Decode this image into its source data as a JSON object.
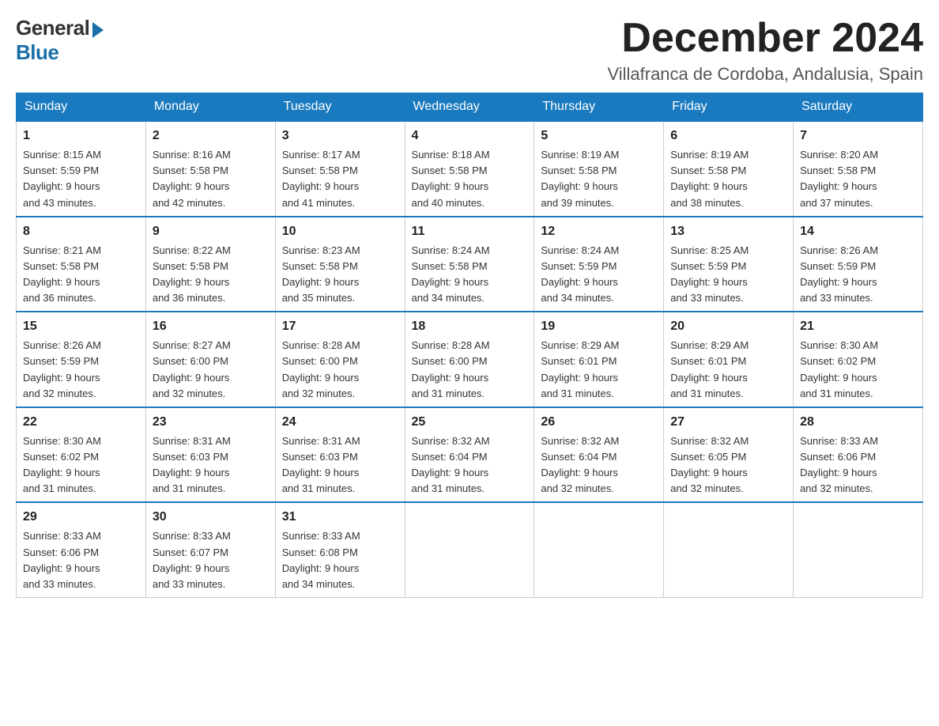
{
  "header": {
    "logo_general": "General",
    "logo_blue": "Blue",
    "month_title": "December 2024",
    "location": "Villafranca de Cordoba, Andalusia, Spain"
  },
  "days_of_week": [
    "Sunday",
    "Monday",
    "Tuesday",
    "Wednesday",
    "Thursday",
    "Friday",
    "Saturday"
  ],
  "weeks": [
    [
      {
        "day": "1",
        "sunrise": "8:15 AM",
        "sunset": "5:59 PM",
        "daylight": "9 hours and 43 minutes."
      },
      {
        "day": "2",
        "sunrise": "8:16 AM",
        "sunset": "5:58 PM",
        "daylight": "9 hours and 42 minutes."
      },
      {
        "day": "3",
        "sunrise": "8:17 AM",
        "sunset": "5:58 PM",
        "daylight": "9 hours and 41 minutes."
      },
      {
        "day": "4",
        "sunrise": "8:18 AM",
        "sunset": "5:58 PM",
        "daylight": "9 hours and 40 minutes."
      },
      {
        "day": "5",
        "sunrise": "8:19 AM",
        "sunset": "5:58 PM",
        "daylight": "9 hours and 39 minutes."
      },
      {
        "day": "6",
        "sunrise": "8:19 AM",
        "sunset": "5:58 PM",
        "daylight": "9 hours and 38 minutes."
      },
      {
        "day": "7",
        "sunrise": "8:20 AM",
        "sunset": "5:58 PM",
        "daylight": "9 hours and 37 minutes."
      }
    ],
    [
      {
        "day": "8",
        "sunrise": "8:21 AM",
        "sunset": "5:58 PM",
        "daylight": "9 hours and 36 minutes."
      },
      {
        "day": "9",
        "sunrise": "8:22 AM",
        "sunset": "5:58 PM",
        "daylight": "9 hours and 36 minutes."
      },
      {
        "day": "10",
        "sunrise": "8:23 AM",
        "sunset": "5:58 PM",
        "daylight": "9 hours and 35 minutes."
      },
      {
        "day": "11",
        "sunrise": "8:24 AM",
        "sunset": "5:58 PM",
        "daylight": "9 hours and 34 minutes."
      },
      {
        "day": "12",
        "sunrise": "8:24 AM",
        "sunset": "5:59 PM",
        "daylight": "9 hours and 34 minutes."
      },
      {
        "day": "13",
        "sunrise": "8:25 AM",
        "sunset": "5:59 PM",
        "daylight": "9 hours and 33 minutes."
      },
      {
        "day": "14",
        "sunrise": "8:26 AM",
        "sunset": "5:59 PM",
        "daylight": "9 hours and 33 minutes."
      }
    ],
    [
      {
        "day": "15",
        "sunrise": "8:26 AM",
        "sunset": "5:59 PM",
        "daylight": "9 hours and 32 minutes."
      },
      {
        "day": "16",
        "sunrise": "8:27 AM",
        "sunset": "6:00 PM",
        "daylight": "9 hours and 32 minutes."
      },
      {
        "day": "17",
        "sunrise": "8:28 AM",
        "sunset": "6:00 PM",
        "daylight": "9 hours and 32 minutes."
      },
      {
        "day": "18",
        "sunrise": "8:28 AM",
        "sunset": "6:00 PM",
        "daylight": "9 hours and 31 minutes."
      },
      {
        "day": "19",
        "sunrise": "8:29 AM",
        "sunset": "6:01 PM",
        "daylight": "9 hours and 31 minutes."
      },
      {
        "day": "20",
        "sunrise": "8:29 AM",
        "sunset": "6:01 PM",
        "daylight": "9 hours and 31 minutes."
      },
      {
        "day": "21",
        "sunrise": "8:30 AM",
        "sunset": "6:02 PM",
        "daylight": "9 hours and 31 minutes."
      }
    ],
    [
      {
        "day": "22",
        "sunrise": "8:30 AM",
        "sunset": "6:02 PM",
        "daylight": "9 hours and 31 minutes."
      },
      {
        "day": "23",
        "sunrise": "8:31 AM",
        "sunset": "6:03 PM",
        "daylight": "9 hours and 31 minutes."
      },
      {
        "day": "24",
        "sunrise": "8:31 AM",
        "sunset": "6:03 PM",
        "daylight": "9 hours and 31 minutes."
      },
      {
        "day": "25",
        "sunrise": "8:32 AM",
        "sunset": "6:04 PM",
        "daylight": "9 hours and 31 minutes."
      },
      {
        "day": "26",
        "sunrise": "8:32 AM",
        "sunset": "6:04 PM",
        "daylight": "9 hours and 32 minutes."
      },
      {
        "day": "27",
        "sunrise": "8:32 AM",
        "sunset": "6:05 PM",
        "daylight": "9 hours and 32 minutes."
      },
      {
        "day": "28",
        "sunrise": "8:33 AM",
        "sunset": "6:06 PM",
        "daylight": "9 hours and 32 minutes."
      }
    ],
    [
      {
        "day": "29",
        "sunrise": "8:33 AM",
        "sunset": "6:06 PM",
        "daylight": "9 hours and 33 minutes."
      },
      {
        "day": "30",
        "sunrise": "8:33 AM",
        "sunset": "6:07 PM",
        "daylight": "9 hours and 33 minutes."
      },
      {
        "day": "31",
        "sunrise": "8:33 AM",
        "sunset": "6:08 PM",
        "daylight": "9 hours and 34 minutes."
      },
      null,
      null,
      null,
      null
    ]
  ],
  "labels": {
    "sunrise": "Sunrise:",
    "sunset": "Sunset:",
    "daylight": "Daylight:"
  }
}
